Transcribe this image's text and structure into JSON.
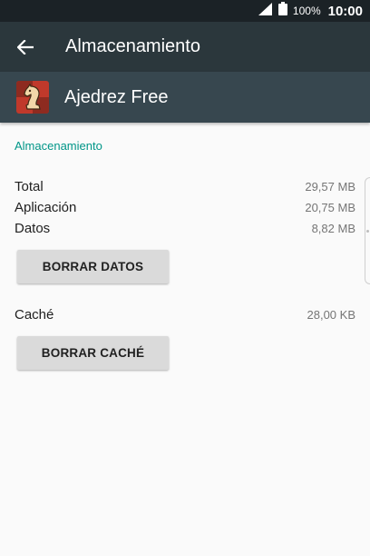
{
  "status_bar": {
    "battery_percent": "100%",
    "time": "10:00",
    "icons": [
      "signal-icon",
      "battery-icon"
    ]
  },
  "app_bar": {
    "title": "Almacenamiento",
    "back_icon": "arrow-back-icon"
  },
  "app_header": {
    "app_name": "Ajedrez Free",
    "app_icon": "chess-knight-icon"
  },
  "storage": {
    "section_title": "Almacenamiento",
    "rows": [
      {
        "label": "Total",
        "value": "29,57 MB"
      },
      {
        "label": "Aplicación",
        "value": "20,75 MB"
      },
      {
        "label": "Datos",
        "value": "8,82 MB"
      }
    ],
    "clear_data_label": "BORRAR DATOS"
  },
  "cache": {
    "label": "Caché",
    "value": "28,00 KB",
    "clear_cache_label": "BORRAR CACHÉ"
  },
  "colors": {
    "status_bar": "#1b2226",
    "app_bar": "#2b373c",
    "app_header": "#37474f",
    "accent": "#009688",
    "background": "#fafafa",
    "button": "#dadada"
  }
}
